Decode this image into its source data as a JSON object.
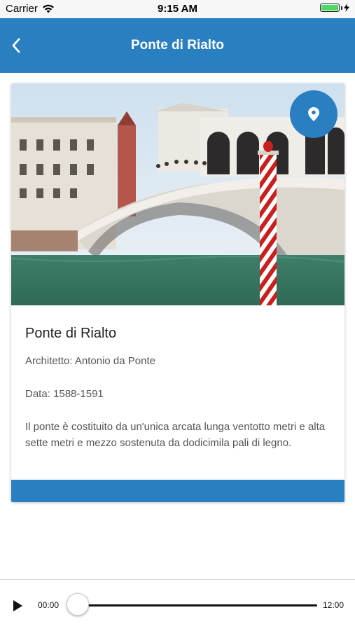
{
  "status_bar": {
    "carrier": "Carrier",
    "time": "9:15 AM",
    "battery_level": 1.0
  },
  "nav": {
    "title": "Ponte di Rialto",
    "back_icon": "chevron-left-icon"
  },
  "card": {
    "title": "Ponte di Rialto",
    "architect": "Architetto: Antonio da Ponte",
    "date": "Data: 1588-1591",
    "description": "Il ponte è costituito da un'unica arcata lunga ventotto metri e alta sette metri e mezzo sostenuta da dodicimila pali di legno.",
    "location_icon": "location-pin-icon",
    "accent_color": "#2a7fc1"
  },
  "player": {
    "current_time": "00:00",
    "total_time": "12:00",
    "progress": 0,
    "play_icon": "play-icon"
  }
}
